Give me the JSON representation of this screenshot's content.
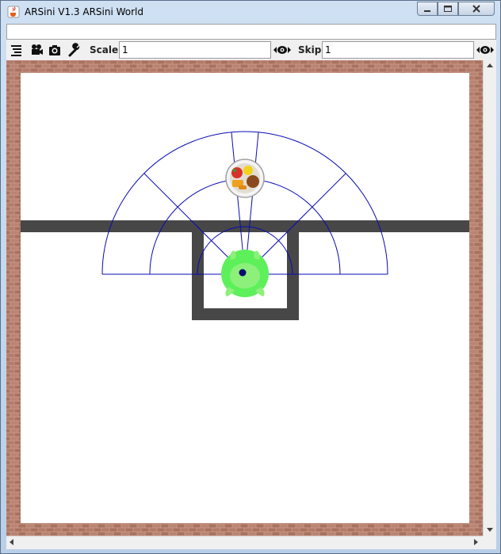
{
  "window": {
    "title": "ARSini V1.3 ARSini World",
    "app_icon": "java-cup-icon",
    "controls": [
      "minimize-icon",
      "maximize-icon",
      "close-icon"
    ]
  },
  "toolbar": {
    "icons": [
      "list-icon",
      "video-camera-icon",
      "camera-icon",
      "wrench-icon"
    ],
    "scale_label": "Scale:",
    "scale_value": "1",
    "skip_label": "Skip:",
    "skip_value": "1",
    "step_icon": "eye-arrows-icon"
  },
  "world": {
    "background": "#ffffff",
    "wall_color": "#474747",
    "border_color": "#b27b6a",
    "sensor_color": "#0a0ab4",
    "agent_color": "#5ef05a",
    "objects": [
      "food-plate",
      "agent-creature"
    ]
  }
}
